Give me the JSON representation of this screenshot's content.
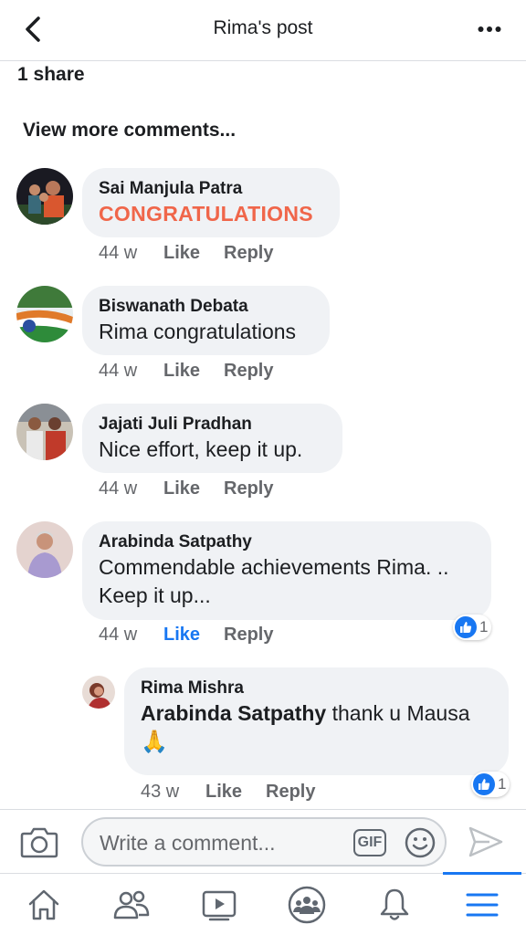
{
  "header": {
    "title": "Rima's post"
  },
  "post": {
    "shares": "1 share",
    "view_more": "View more comments..."
  },
  "comments": [
    {
      "author": "Sai Manjula Patra",
      "text": "CONGRATULATIONS",
      "time": "44 w",
      "like": "Like",
      "reply": "Reply"
    },
    {
      "author": "Biswanath Debata",
      "text": "Rima congratulations",
      "time": "44 w",
      "like": "Like",
      "reply": "Reply"
    },
    {
      "author": "Jajati Juli Pradhan",
      "text": "Nice effort, keep it up.",
      "time": "44 w",
      "like": "Like",
      "reply": "Reply"
    },
    {
      "author": "Arabinda Satpathy",
      "text_line1": "Commendable achievements Rima. ..",
      "text_line2": "Keep it up...",
      "time": "44 w",
      "like": "Like",
      "reply": "Reply",
      "reaction_count": "1",
      "liked": true
    }
  ],
  "reply": {
    "author": "Rima Mishra",
    "mention": "Arabinda Satpathy",
    "text": " thank u Mausa",
    "emoji": "🙏",
    "time": "43 w",
    "like": "Like",
    "reply": "Reply",
    "reaction_count": "1"
  },
  "composer": {
    "placeholder": "Write a comment...",
    "gif_label": "GIF"
  },
  "colors": {
    "accent": "#1877f2",
    "bubble": "#f0f2f5",
    "muted": "#65676b",
    "congrats": "#f0664a"
  }
}
